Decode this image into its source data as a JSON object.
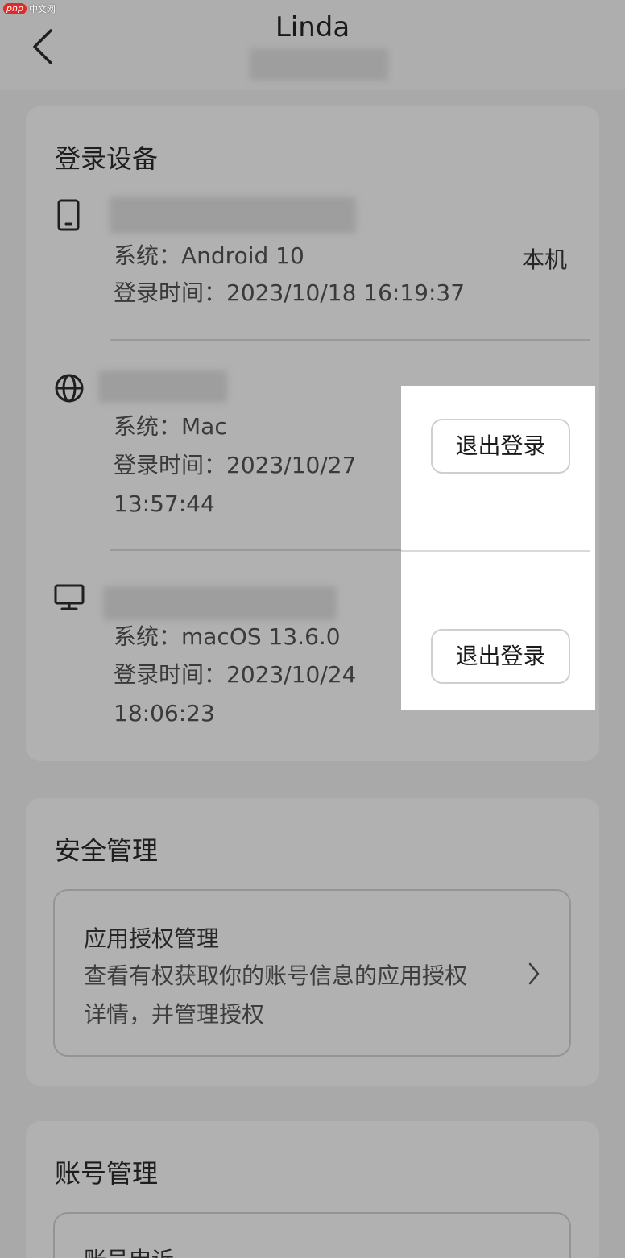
{
  "watermark": {
    "brand": "php",
    "site": "中文网"
  },
  "header": {
    "title": "Linda"
  },
  "devices_section": {
    "title": "登录设备",
    "devices": [
      {
        "icon": "phone-icon",
        "system": "系统：Android 10",
        "login_time_line1": "登录时间：2023/10/18 16:19:37",
        "login_time_line2": "",
        "tag": "本机"
      },
      {
        "icon": "globe-icon",
        "system": "系统：Mac",
        "login_time_line1": "登录时间：2023/10/27",
        "login_time_line2": "13:57:44",
        "action": "退出登录"
      },
      {
        "icon": "desktop-icon",
        "system": "系统：macOS 13.6.0",
        "login_time_line1": "登录时间：2023/10/24",
        "login_time_line2": "18:06:23",
        "action": "退出登录"
      }
    ]
  },
  "security_section": {
    "title": "安全管理",
    "auth": {
      "title": "应用授权管理",
      "description": "查看有权获取你的账号信息的应用授权详情，并管理授权"
    }
  },
  "account_section": {
    "title": "账号管理",
    "complaint": "账号申诉"
  }
}
